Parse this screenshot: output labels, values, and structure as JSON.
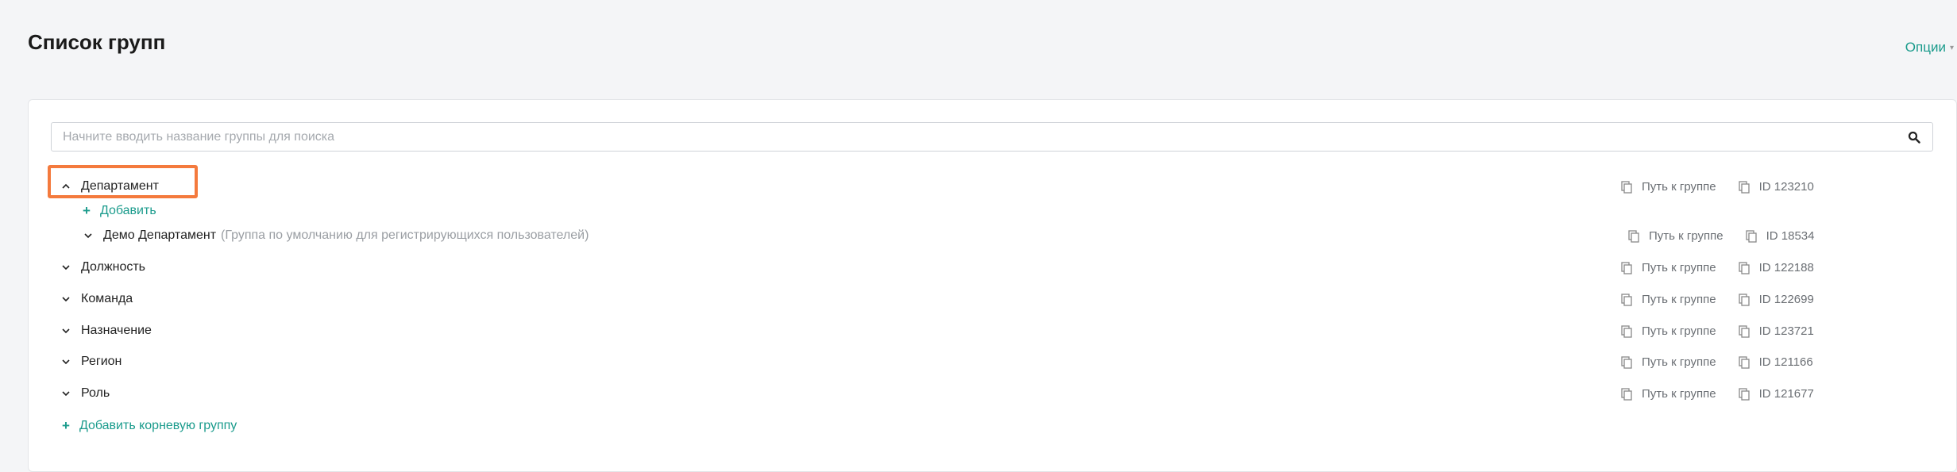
{
  "header": {
    "title": "Список групп",
    "options_label": "Опции"
  },
  "search": {
    "placeholder": "Начните вводить название группы для поиска",
    "value": ""
  },
  "meta_labels": {
    "path": "Путь к группе"
  },
  "tree": {
    "department": {
      "label": "Департамент",
      "id": "ID 123210",
      "expanded": true,
      "add_label": "Добавить",
      "children": [
        {
          "label": "Демо Департамент",
          "hint": "(Группа по умолчанию для регистрирующихся пользователей)",
          "id": "ID 18534"
        }
      ]
    },
    "groups": [
      {
        "label": "Должность",
        "id": "ID 122188"
      },
      {
        "label": "Команда",
        "id": "ID 122699"
      },
      {
        "label": "Назначение",
        "id": "ID 123721"
      },
      {
        "label": "Регион",
        "id": "ID 121166"
      },
      {
        "label": "Роль",
        "id": "ID 121677"
      }
    ],
    "add_root_label": "Добавить корневую группу"
  },
  "colors": {
    "accent": "#1a9b8c",
    "highlight": "#f47a3d"
  }
}
